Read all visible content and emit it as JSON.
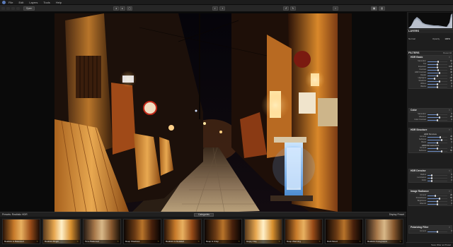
{
  "menubar": {
    "items": [
      "File",
      "Edit",
      "Layers",
      "Tools",
      "Help"
    ]
  },
  "toolbar": {
    "open_label": "Open"
  },
  "panel": {
    "layers_title": "LAYERS",
    "layer_mode": "Normal",
    "opacity_label": "Opacity",
    "opacity_value": "100%",
    "layer_name": "New HDR Filtrage",
    "filters_title": "FILTERS",
    "filters_action": "Reset All",
    "groups": [
      {
        "title": "HDR Basic",
        "sliders": [
          {
            "label": "Saturation",
            "value": "10",
            "level": 0.55
          },
          {
            "label": "Tint",
            "value": "0",
            "level": 0.5
          },
          {
            "label": "Exposure",
            "value": "0.00",
            "level": 0.5
          },
          {
            "label": "Contrast",
            "value": "10",
            "level": 0.55
          },
          {
            "label": "HDR Contrast",
            "value": "30",
            "level": 0.62
          },
          {
            "label": "Details",
            "value": "0",
            "level": 0.5
          },
          {
            "label": "Highlights",
            "value": "-40",
            "level": 0.35
          },
          {
            "label": "Shadows",
            "value": "30",
            "level": 0.62
          },
          {
            "label": "Whites",
            "value": "0",
            "level": 0.5
          },
          {
            "label": "Blacks",
            "value": "0",
            "level": 0.5
          }
        ]
      },
      {
        "title": "Color",
        "sliders": [
          {
            "label": "Saturation",
            "value": "0",
            "level": 0.5
          },
          {
            "label": "Vibrance",
            "value": "25",
            "level": 0.6
          },
          {
            "label": "Color Contrast",
            "value": "0",
            "level": 0.5
          }
        ]
      },
      {
        "title": "HDR Structure",
        "subtitle": "HDR Structure",
        "sliders": [
          {
            "label": "Amount",
            "value": "40",
            "level": 0.65
          },
          {
            "label": "Softness",
            "value": "50",
            "level": 0.7
          },
          {
            "label": "Boost",
            "value": "0",
            "level": 0.5
          }
        ],
        "subtitle2": "HDR Microstructure",
        "sliders2": [
          {
            "label": "Amount",
            "value": "0",
            "level": 0.5
          },
          {
            "label": "Softness",
            "value": "50",
            "level": 0.7
          }
        ]
      },
      {
        "title": "HDR Denoise",
        "sliders": [
          {
            "label": "Radius",
            "value": "0",
            "level": 0.2
          },
          {
            "label": "Luminance",
            "value": "0",
            "level": 0.2
          },
          {
            "label": "Color",
            "value": "0",
            "level": 0.2
          }
        ]
      },
      {
        "title": "Image Radiance",
        "sliders": [
          {
            "label": "Amount",
            "value": "20",
            "level": 0.4
          },
          {
            "label": "Smoothness",
            "value": "50",
            "level": 0.6
          },
          {
            "label": "Brightness",
            "value": "0",
            "level": 0.5
          },
          {
            "label": "Warmth",
            "value": "0",
            "level": 0.5
          }
        ]
      },
      {
        "title": "Polarizing Filter",
        "sliders": [
          {
            "label": "Amount",
            "value": "0",
            "level": 0.5
          }
        ]
      }
    ],
    "footer_action": "Save Filter as Preset"
  },
  "strip": {
    "left_label": "Presets: Realistic HDR",
    "center_label": "Categories",
    "right_label": "Display Preset",
    "presets": [
      {
        "name": "Realistic & Balanced",
        "tone": "warm"
      },
      {
        "name": "Realistic Bright",
        "tone": "bright"
      },
      {
        "name": "Tone Balanced",
        "tone": "neutral"
      },
      {
        "name": "Deep Shadows",
        "tone": "dark"
      },
      {
        "name": "Realistic & Detailed",
        "tone": "warm"
      },
      {
        "name": "Deep & Crisp",
        "tone": "dark"
      },
      {
        "name": "Happy Day",
        "tone": "bright"
      },
      {
        "name": "Deep Warming",
        "tone": "warm"
      },
      {
        "name": "Dark Mood",
        "tone": "dark"
      },
      {
        "name": "Realistic Foreground",
        "tone": "neutral"
      }
    ]
  },
  "colors": {
    "accent": "#6f8fc7",
    "panel_bg": "#1e1e1e",
    "photo_warm": "#e59a3a",
    "photo_deep": "#1a0d05"
  }
}
